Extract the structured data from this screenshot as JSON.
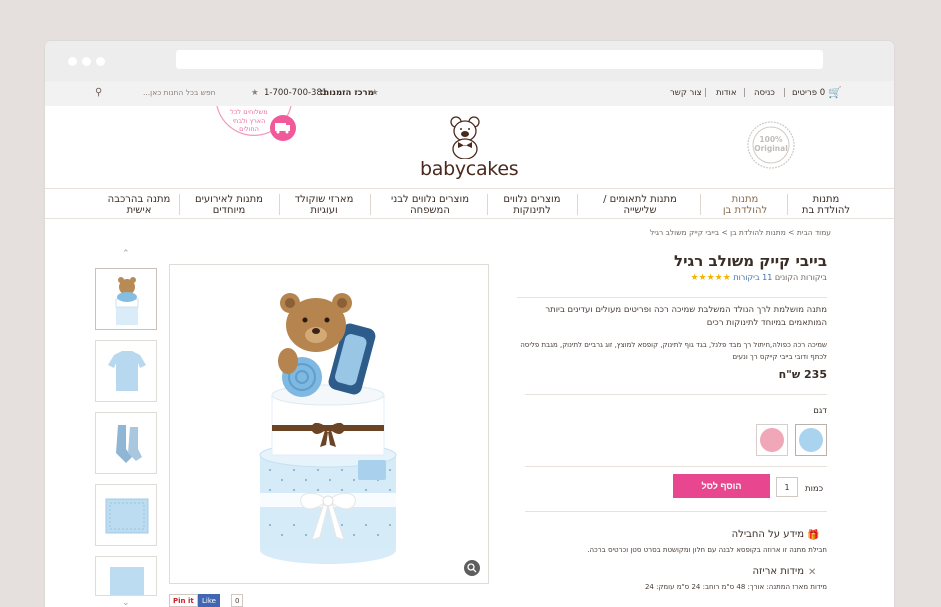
{
  "topbar": {
    "cart_count": "0 פריטים",
    "checkout": "כניסה",
    "about": "אודות",
    "contact": "צור קשר",
    "phone": "1-700-700-381",
    "phone_label": "מרכז הזמנות:",
    "search_placeholder": "חפש בכל החנות כאן..."
  },
  "header": {
    "logo_text": "babycakes",
    "badge_text": "100% Original",
    "stamp_text": "משלוחים לכל הארץ ולבתי החולים"
  },
  "nav": {
    "items": [
      {
        "label": "מתנות\nלהולדת בת"
      },
      {
        "label": "מתנות\nלהולדת בן"
      },
      {
        "label": "מתנות לתאומים /\nשלישייה"
      },
      {
        "label": "מוצרים נלווים\nלתינוקות"
      },
      {
        "label": "מוצרים נלווים לבני\nהמשפחה"
      },
      {
        "label": "מארזי שוקולד\nועוגיות"
      },
      {
        "label": "מתנות לאירועים\nמיוחדים"
      },
      {
        "label": "מתנה בהרכבה\nאישית"
      }
    ]
  },
  "breadcrumb": "עמוד הבית  >  מתנות להולדת בן  >  בייבי קייק משולב רגיל",
  "product": {
    "title": "בייבי קייק משולב רגיל",
    "reviews": "11 ביקורות",
    "reviews_suffix": "ביקורות הקונים",
    "rating": 5,
    "description": "מתנה מושלמת לרך הנולד המשלבת שמיכה רכה ופריטים מעולים ועדינים ביותר המותאמים במיוחד לתינוקות רכים",
    "contents": "שמיכה רכה כפולה,חיתול רך מבד פלנל, בגד גוף לתינוק, קופסא למוצץ, זוג גרביים לתינוק, מגבת פליסה לכתף ודובי בייבי קייקס רך ונעים",
    "price": "235 ש\"ח",
    "model_label": "דגם",
    "qty_label": "כמות",
    "qty_value": "1",
    "add_to_cart": "הוסף לסל",
    "package_info_title": "מידע על החבילה",
    "package_info_text": "חבילת מתנה זו ארוזה בקופסא לבנה עם חלון ומקושטת בסרט סטן וכרטיס ברכה.",
    "dimensions_title": "מידות אריזה",
    "dimensions_text": "מידות מארז המתנה: אורך: 48 ס\"מ רוחב: 24 ס\"מ עומק: 24"
  },
  "colors": {
    "accent": "#e8478f",
    "brown": "#4a2a1d",
    "swatch_pink": "#f0a7b8",
    "swatch_blue": "#a9d3ee"
  },
  "social": {
    "pin": "Pin it",
    "like": "Like",
    "like_count": "0"
  }
}
